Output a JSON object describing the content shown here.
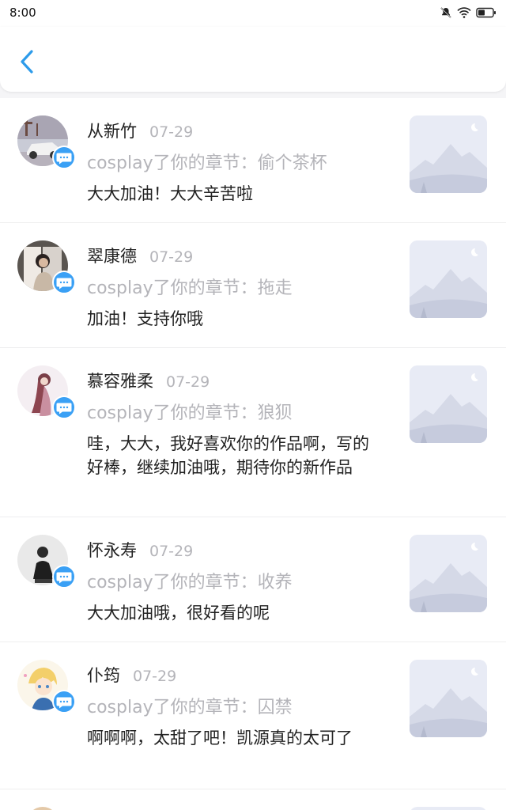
{
  "status": {
    "time": "8:00"
  },
  "header": {
    "back_icon": "chevron-left-icon"
  },
  "messages": [
    {
      "name": "从新竹",
      "date": "07-29",
      "action": "cosplay了你的章节：偷个茶杯",
      "comment": "大大加油！大大辛苦啦"
    },
    {
      "name": "翠康德",
      "date": "07-29",
      "action": "cosplay了你的章节：拖走",
      "comment": "加油！支持你哦"
    },
    {
      "name": "慕容雅柔",
      "date": "07-29",
      "action": "cosplay了你的章节：狼狈",
      "comment": "哇，大大，我好喜欢你的作品啊，写的好棒，继续加油哦，期待你的新作品"
    },
    {
      "name": "怀永寿",
      "date": "07-29",
      "action": "cosplay了你的章节：收养",
      "comment": "大大加油哦，很好看的呢"
    },
    {
      "name": "仆筠",
      "date": "07-29",
      "action": "cosplay了你的章节：囚禁",
      "comment": "啊啊啊，太甜了吧！凯源真的太可了"
    }
  ],
  "colors": {
    "accent": "#3aa0f5",
    "muted_text": "#b4b4b9",
    "placeholder_bg": "#eef0f7"
  }
}
